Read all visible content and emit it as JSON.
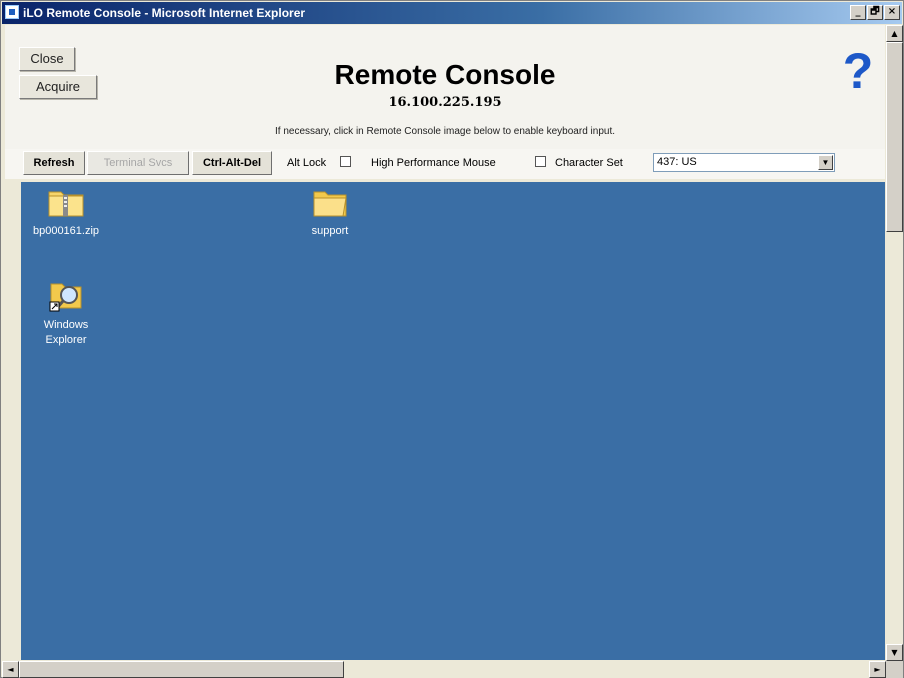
{
  "window": {
    "title": "iLO Remote Console - Microsoft Internet Explorer",
    "minimize": "_",
    "maximize": "🗗",
    "close": "×"
  },
  "header": {
    "close_label": "Close",
    "acquire_label": "Acquire",
    "title": "Remote Console",
    "ip": "16.100.225.195",
    "hint": "If necessary, click in Remote Console image below to enable keyboard input.",
    "help_glyph": "?"
  },
  "toolbar": {
    "refresh_label": "Refresh",
    "terminal_label": "Terminal Svcs",
    "cad_label": "Ctrl-Alt-Del",
    "altlock_label": "Alt Lock",
    "mouse_label": "High Performance Mouse",
    "charset_label": "Character Set",
    "charset_value": "437: US"
  },
  "desktop": {
    "background": "#3a6ea5",
    "icons": [
      {
        "label": "bp000161.zip",
        "icon": "zip-folder-icon"
      },
      {
        "label": "support",
        "icon": "folder-icon"
      },
      {
        "label": "Windows Explorer",
        "icon": "windows-explorer-icon"
      }
    ]
  },
  "scrollbars": {
    "up": "▲",
    "down": "▼",
    "left": "◄",
    "right": "►"
  }
}
